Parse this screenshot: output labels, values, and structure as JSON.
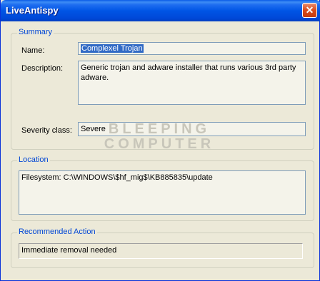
{
  "window": {
    "title": "LiveAntispy",
    "close_glyph": "✕"
  },
  "summary": {
    "legend": "Summary",
    "name_label": "Name:",
    "name_value": "Complexel Trojan",
    "description_label": "Description:",
    "description_value": "Generic trojan and adware installer that runs various 3rd party adware.",
    "severity_label": "Severity class:",
    "severity_value": "Severe"
  },
  "location": {
    "legend": "Location",
    "value": "Filesystem: C:\\WINDOWS\\$hf_mig$\\KB885835\\update"
  },
  "recommended": {
    "legend": "Recommended Action",
    "value": "Immediate removal needed"
  },
  "watermark": {
    "line1": "BLEEPING",
    "line2": "COMPUTER"
  }
}
